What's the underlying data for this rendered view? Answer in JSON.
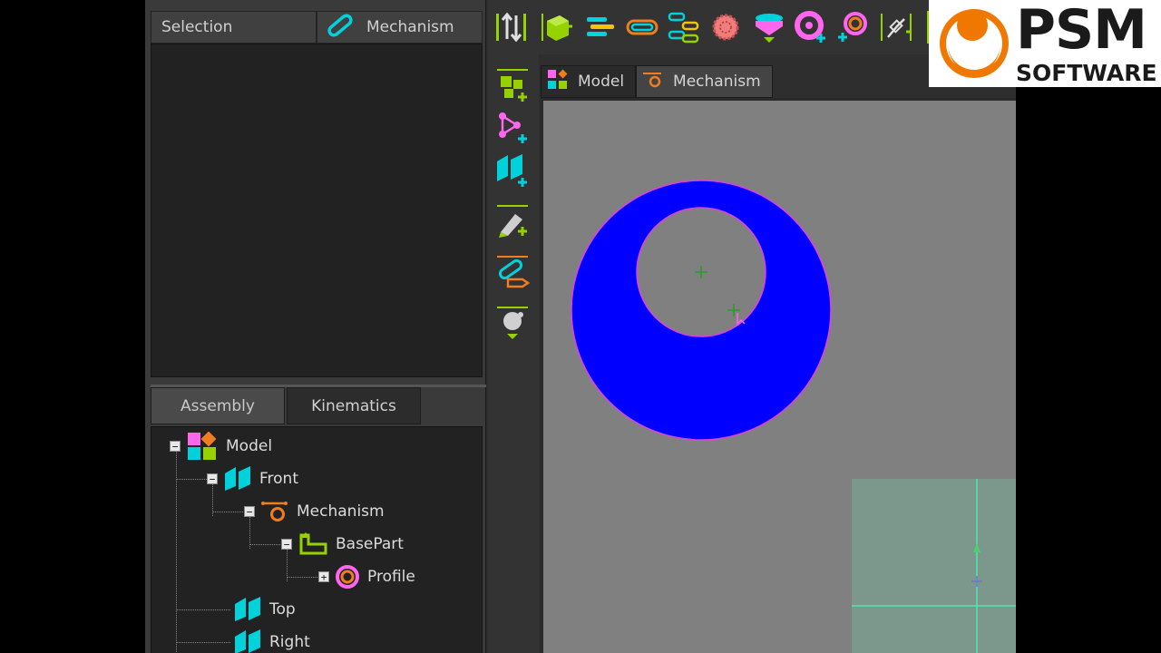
{
  "selection_panel": {
    "selection_label": "Selection",
    "mechanism_label": "Mechanism"
  },
  "tree_tabs": {
    "assembly": "Assembly",
    "kinematics": "Kinematics"
  },
  "tree": {
    "model": "Model",
    "front": "Front",
    "mechanism": "Mechanism",
    "basepart": "BasePart",
    "profile": "Profile",
    "top": "Top",
    "right": "Right",
    "expanded_symbol": "−",
    "collapsed_symbol": "+"
  },
  "doc_tabs": {
    "model": "Model",
    "mechanism": "Mechanism"
  },
  "logo": {
    "line1": "PSM",
    "line2": "SOFTWARE"
  },
  "colors": {
    "shape_fill": "#0000ff",
    "shape_outline": "#e040e0",
    "viewport_bg": "#808080",
    "grid_panel": "#7c978c",
    "axis_line": "#4de8b0",
    "cyan_plane": "#00d2dc",
    "orange_mech": "#f07d1e",
    "lime_part": "#96d200",
    "logo_orange": "#f07800"
  },
  "toolbar_icons": [
    "sort-icon",
    "part-icon",
    "lines-icon",
    "slot-icon",
    "link-chain-icon",
    "gear-icon",
    "cam-icon",
    "circle-add-icon",
    "ring-add-icon",
    "slider-icon"
  ],
  "vertical_icons": [
    "add-part-icon",
    "add-graph-icon",
    "add-plane-icon",
    "edit-part-icon",
    "edit-slot-icon",
    "drop-object-icon"
  ]
}
